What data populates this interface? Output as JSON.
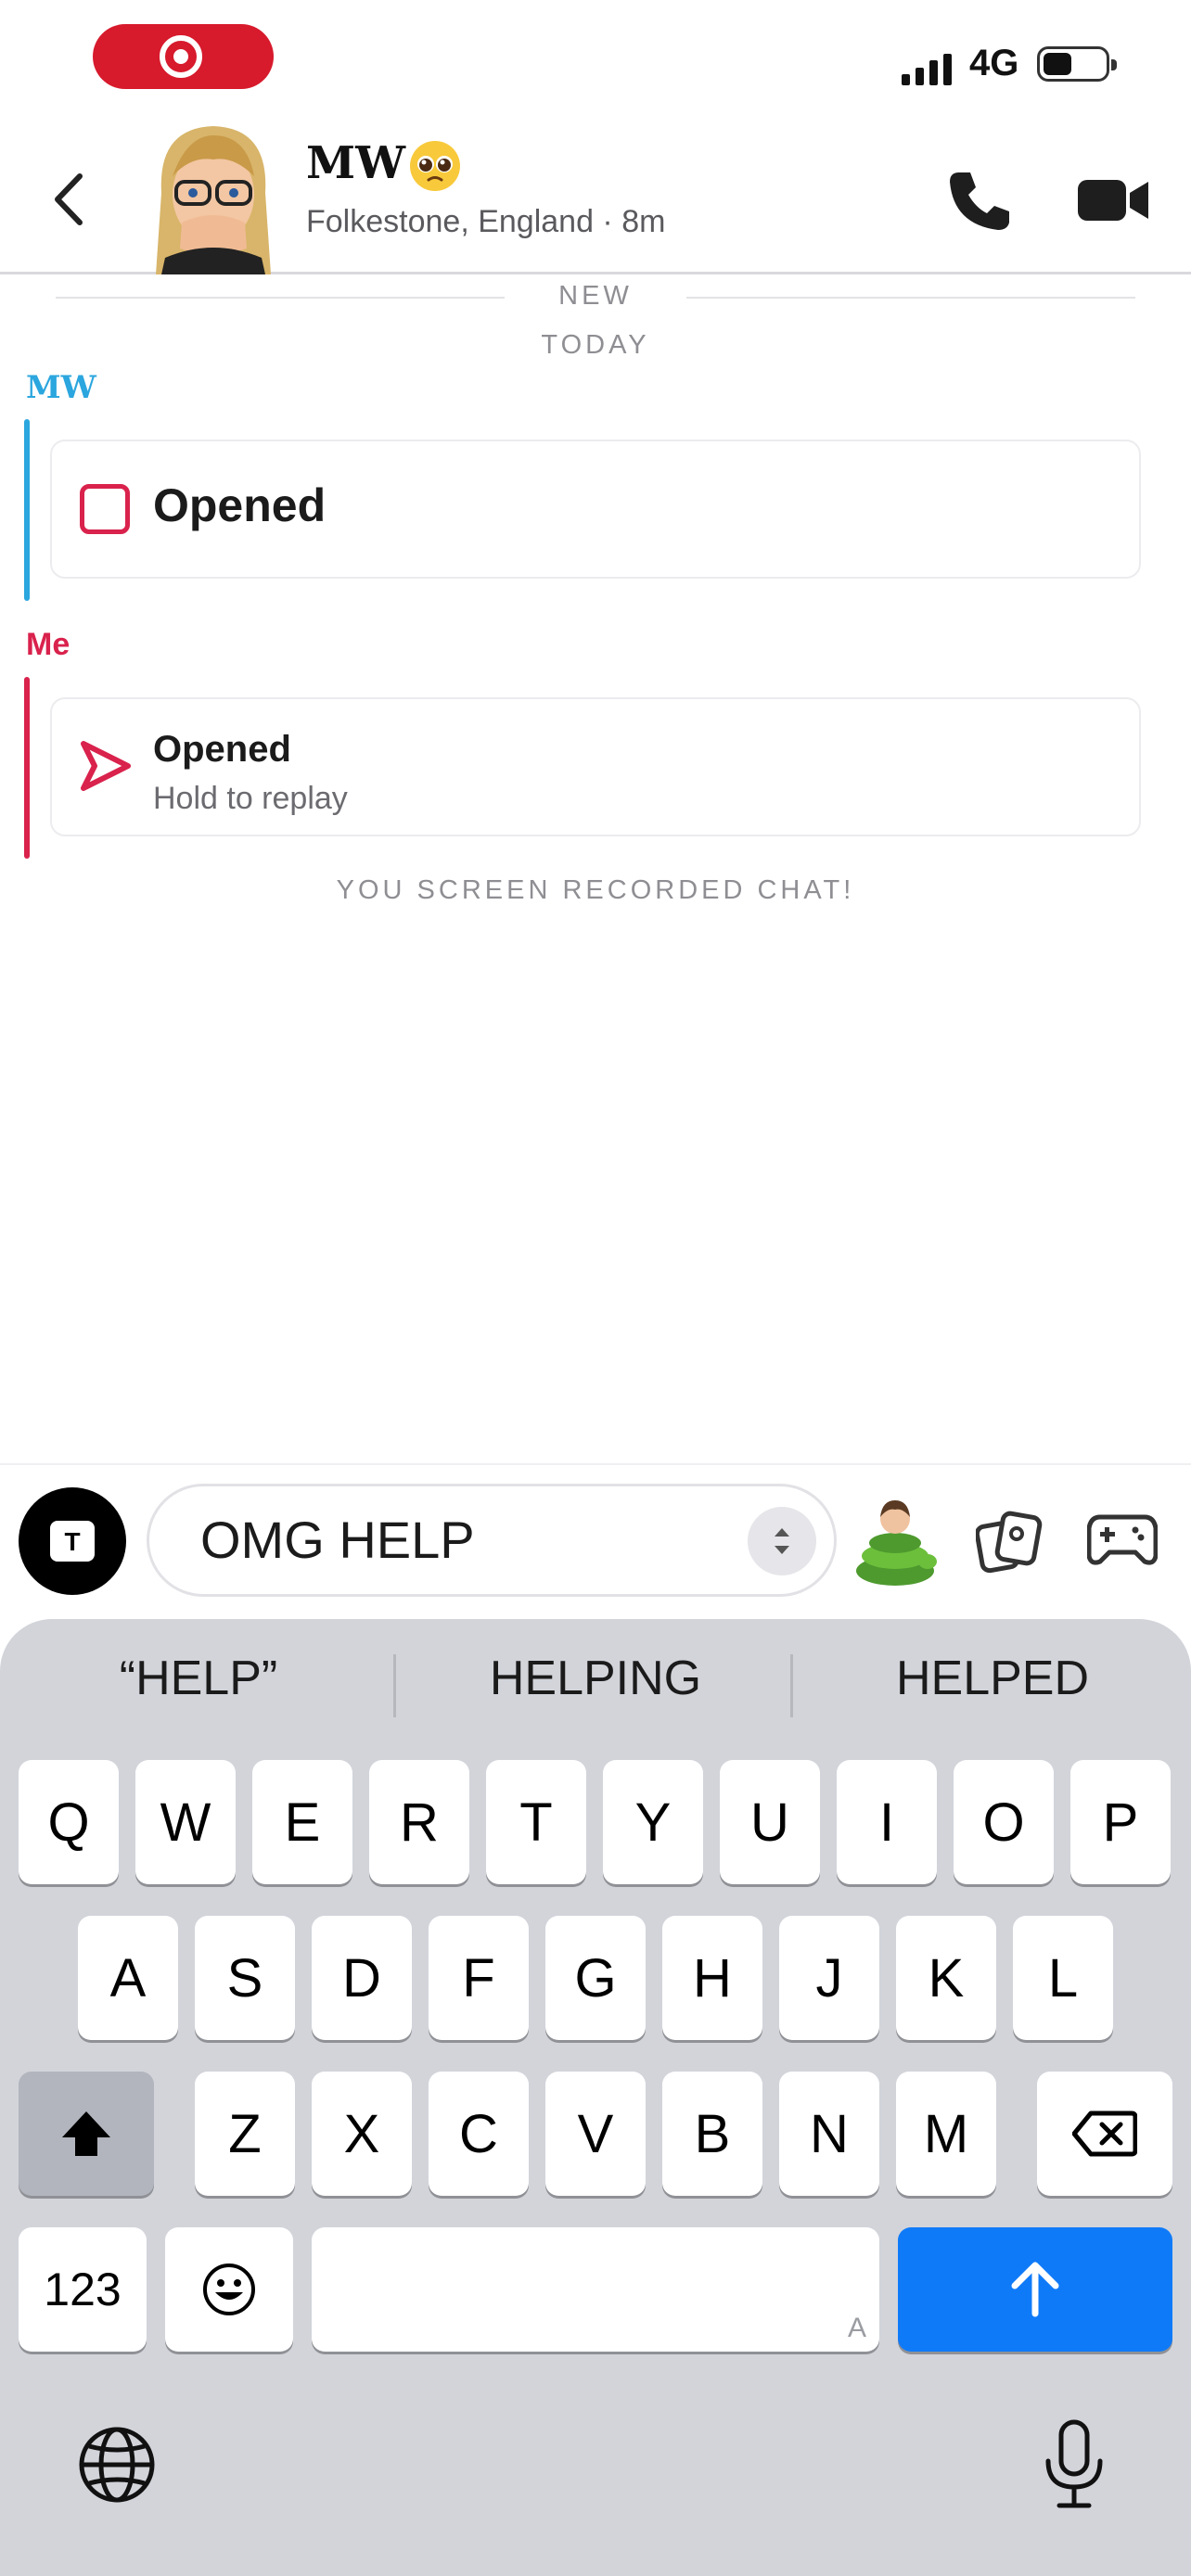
{
  "status_bar": {
    "network": "4G",
    "icons": [
      "screen-record-icon",
      "signal-icon",
      "battery-icon"
    ]
  },
  "header": {
    "name": "MW",
    "emoji": "pleading-face",
    "subtitle": "Folkestone, England · 8m",
    "icons": [
      "back-icon",
      "avatar",
      "phone-icon",
      "video-icon"
    ]
  },
  "chat": {
    "new_label": "NEW",
    "today_label": "TODAY",
    "messages": [
      {
        "sender": "MW",
        "status": "Opened",
        "color": "#2ba6de"
      },
      {
        "sender": "Me",
        "status": "Opened",
        "detail": "Hold to replay",
        "color": "#d9224c"
      }
    ],
    "notice": "YOU SCREEN RECORDED CHAT!"
  },
  "compose": {
    "camera_label": "T",
    "message": "OMG HELP",
    "icons": [
      "camera-icon",
      "stepper-icon",
      "bitmoji-icon",
      "cards-icon",
      "game-controller-icon"
    ]
  },
  "keyboard": {
    "suggestions": [
      "“HELP”",
      "HELPING",
      "HELPED"
    ],
    "row1": [
      "Q",
      "W",
      "E",
      "R",
      "T",
      "Y",
      "U",
      "I",
      "O",
      "P"
    ],
    "row2": [
      "A",
      "S",
      "D",
      "F",
      "G",
      "H",
      "J",
      "K",
      "L"
    ],
    "row3": [
      "Z",
      "X",
      "C",
      "V",
      "B",
      "N",
      "M"
    ],
    "numbers_label": "123",
    "space_hint": "A",
    "accent_color": "#0f7af8"
  }
}
